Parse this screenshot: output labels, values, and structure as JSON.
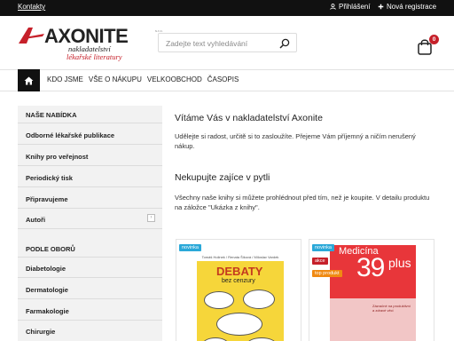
{
  "topbar": {
    "contact": "Kontakty",
    "login": "Přihlášení",
    "register": "Nová registrace"
  },
  "logo": {
    "wordmark": "AXONITE",
    "suffix": "s.r.o.",
    "line1": "nakladatelství",
    "line2": "lékařské literatury"
  },
  "search": {
    "placeholder": "Zadejte text vyhledávání"
  },
  "cart": {
    "count": "0"
  },
  "nav": {
    "items": [
      "KDO JSME",
      "VŠE O NÁKUPU",
      "VELKOOBCHOD",
      "ČASOPIS"
    ]
  },
  "sidebar": {
    "offer_heading": "NAŠE NABÍDKA",
    "offer_items": [
      "Odborné lékařské publikace",
      "Knihy pro veřejnost",
      "Periodický tisk",
      "Připravujeme",
      "Autoři"
    ],
    "fields_heading": "PODLE OBORŮ",
    "field_items": [
      "Diabetologie",
      "Dermatologie",
      "Farmakologie",
      "Chirurgie"
    ]
  },
  "main": {
    "welcome_title": "Vítáme Vás v nakladatelství Axonite",
    "welcome_text": "Udělejte si radost, určitě si to zasloužíte. Přejeme Vám příjemný a ničím nerušený nákup.",
    "buy_title": "Nekupujte zajíce v pytli",
    "buy_text": "Všechny naše knihy si můžete prohlédnout před tím, než je koupite. V detailu produktu na záložce \"Ukázka z knihy\"."
  },
  "products": [
    {
      "tags": [
        "novinka"
      ],
      "cover_title": "DEBATY",
      "cover_sub": "bez cenzury",
      "cover_top": "Tomáš Holinek / Renata Šiková / Miloslav Vardek"
    },
    {
      "tags": [
        "novinka",
        "akce",
        "top produkt"
      ],
      "cover_title": "Medicína",
      "cover_number": "39",
      "cover_plus": "plus",
      "cover_note": "Zázračné na produktivní a zdravé věci"
    }
  ],
  "colors": {
    "topbar": "#111111",
    "brand_red": "#c6202a",
    "tag_new": "#2aa8d8",
    "tag_top": "#f08a12",
    "sidebar_bg": "#f2f2f2"
  }
}
